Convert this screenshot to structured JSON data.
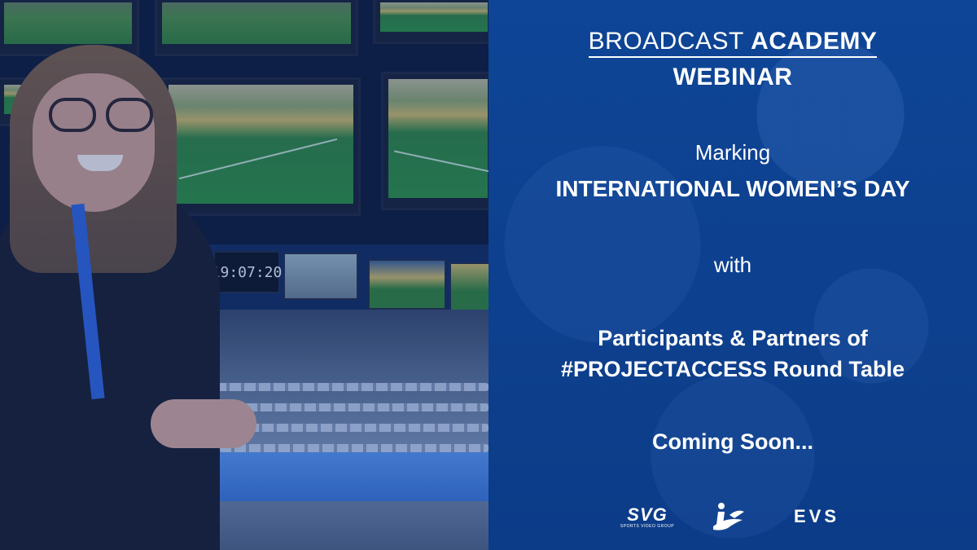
{
  "photo": {
    "clock_readout": "19:07:20"
  },
  "panel": {
    "brand_light": "BROADCAST",
    "brand_bold": "ACADEMY",
    "webinar": "WEBINAR",
    "marking": "Marking",
    "event": "INTERNATIONAL WOMEN’S DAY",
    "with": "with",
    "participants_line1": "Participants & Partners of",
    "participants_line2": "#PROJECTACCESS Round Table",
    "coming_soon": "Coming Soon..."
  },
  "logos": {
    "svg_main": "SVG",
    "svg_sub": "SPORTS VIDEO GROUP",
    "ibc": "ibc",
    "evs": "EVS"
  },
  "colors": {
    "panel_background": "#0d3f8c",
    "text": "#ffffff"
  }
}
